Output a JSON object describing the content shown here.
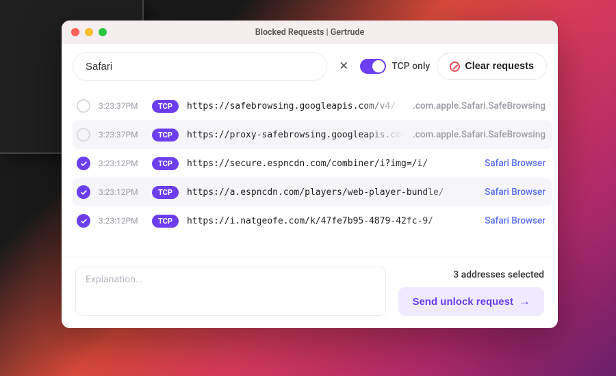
{
  "window": {
    "title": "Blocked Requests  |  Gertrude"
  },
  "toolbar": {
    "search_value": "Safari",
    "toggle_label": "TCP only",
    "clear_label": "Clear requests"
  },
  "requests": [
    {
      "selected": false,
      "time": "3:23:37PM",
      "protocol": "TCP",
      "url": "https://safebrowsing.googleapis.com/v4/",
      "app": ".com.apple.Safari.SafeBrowsing",
      "app_kind": "system"
    },
    {
      "selected": false,
      "time": "3:23:37PM",
      "protocol": "TCP",
      "url": "https://proxy-safebrowsing.googleapis.com/",
      "app": ".com.apple.Safari.SafeBrowsing",
      "app_kind": "system"
    },
    {
      "selected": true,
      "time": "3:23:12PM",
      "protocol": "TCP",
      "url": "https://secure.espncdn.com/combiner/i?img=/i/",
      "app": "Safari Browser",
      "app_kind": "safari"
    },
    {
      "selected": true,
      "time": "3:23:12PM",
      "protocol": "TCP",
      "url": "https://a.espncdn.com/players/web-player-bundle/",
      "app": "Safari Browser",
      "app_kind": "safari"
    },
    {
      "selected": true,
      "time": "3:23:12PM",
      "protocol": "TCP",
      "url": "https://i.natgeofe.com/k/47fe7b95-4879-42fc-9/",
      "app": "Safari Browser",
      "app_kind": "safari"
    }
  ],
  "footer": {
    "explanation_placeholder": "Explanation...",
    "selected_text": "3 addresses selected",
    "send_label": "Send unlock request"
  }
}
